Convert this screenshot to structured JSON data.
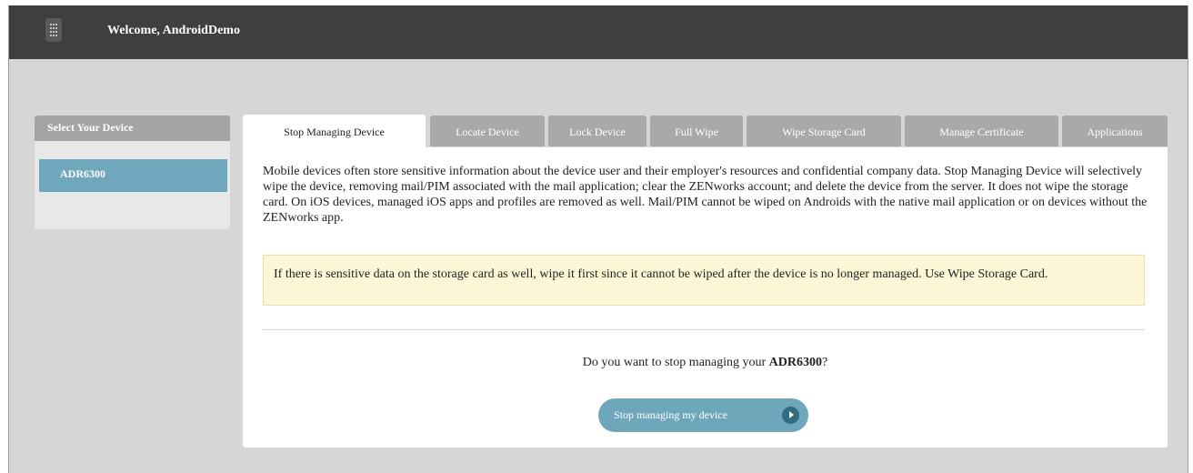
{
  "header": {
    "welcome_text": "Welcome, AndroidDemo",
    "logo_icon": "building-icon",
    "background": "#3d3f41"
  },
  "sidebar": {
    "heading": "Select Your Device",
    "devices": [
      {
        "label": "ADR6300",
        "selected": true
      }
    ]
  },
  "tabs": [
    {
      "label": "Stop Managing Device",
      "active": true
    },
    {
      "label": "Locate Device",
      "active": false
    },
    {
      "label": "Lock Device",
      "active": false
    },
    {
      "label": "Full Wipe",
      "active": false
    },
    {
      "label": "Wipe Storage Card",
      "active": false
    },
    {
      "label": "Manage Certificate",
      "active": false
    },
    {
      "label": "Applications",
      "active": false
    }
  ],
  "panel": {
    "description": "Mobile devices often store sensitive information about the device user and their employer's resources and confidential company data. Stop Managing Device will selectively wipe the device, removing mail/PIM associated with the mail application; clear the ZENworks account; and delete the device from the server. It does not wipe the storage card. On iOS devices, managed iOS apps and profiles are removed as well. Mail/PIM cannot be wiped on Androids with the native mail application or on devices without the ZENworks app.",
    "notice": "If there is sensitive data on the storage card as well, wipe it first since it cannot be wiped after the device is no longer managed. Use Wipe Storage Card.",
    "question_prefix": "Do you want to stop managing your ",
    "question_device": "ADR6300",
    "question_suffix": "?",
    "button_label": "Stop managing my device",
    "button_icon": "arrow-right-circle-icon"
  },
  "colors": {
    "accent": "#6fa8bd",
    "tab_inactive": "#a9a9a9",
    "notice_bg": "#fbf7d6"
  }
}
